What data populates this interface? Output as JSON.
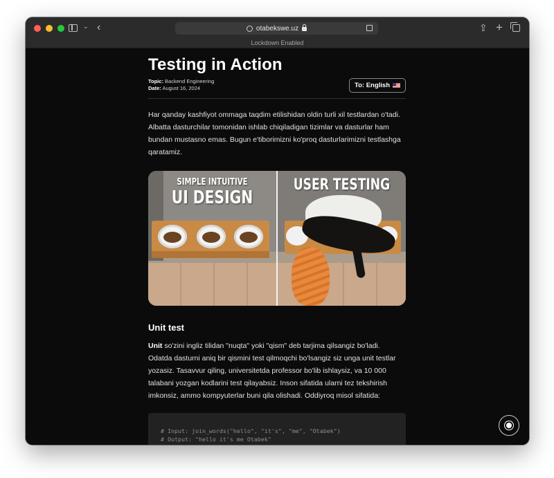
{
  "browser": {
    "url": "otabekswe.uz",
    "banner": "Lockdown Enabled"
  },
  "article": {
    "title": "Testing in Action",
    "topic_label": "Topic:",
    "topic": "Backend Engineering",
    "date_label": "Date:",
    "date": "August 16, 2024",
    "language_button": "To: English",
    "intro": "Har qanday kashfiyot ommaga taqdim etilishidan oldin turli xil testlardan o'tadi. Albatta dasturchilar tomonidan ishlab chiqiladigan tizimlar va dasturlar ham bundan mustasno emas. Bugun e'tiborimizni ko'proq dasturlarimizni testlashga qaratamiz.",
    "meme": {
      "left_caption_small": "SIMPLE INTUITIVE",
      "left_caption_big": "UI DESIGN",
      "right_caption": "USER TESTING"
    },
    "section_heading": "Unit test",
    "section_para_bold": "Unit",
    "section_para_rest": " so'zini ingliz tilidan \"nuqta\" yoki \"qism\" deb tarjima qilsangiz bo'ladi. Odatda dasturni aniq bir qismini test qilmoqchi bo'lsangiz siz unga unit testlar yozasiz. Tasavvur qiling, universitetda professor bo'lib ishlaysiz, va 10 000 talabani yozgan kodlarini test qilayabsiz. Inson sifatida ularni tez tekshirish imkonsiz, ammo kompyuterlar buni qila olishadi. Oddiyroq misol sifatida:",
    "code": [
      "# Input: join_words(\"hello\", \"it's\", \"me\", \"Otabek\")",
      "# Output: \"hello it's me Otabek\""
    ]
  },
  "colors": {
    "background": "#0b0b0b",
    "toolbar": "#2b2b2b",
    "text": "#e2e2e2",
    "code_bg": "#222222"
  },
  "icons": [
    "sidebar-icon",
    "chevron-down-icon",
    "back-icon",
    "globe-icon",
    "lock-icon",
    "reader-icon",
    "share-icon",
    "plus-icon",
    "tabs-icon",
    "flag-icon",
    "sun-icon"
  ]
}
